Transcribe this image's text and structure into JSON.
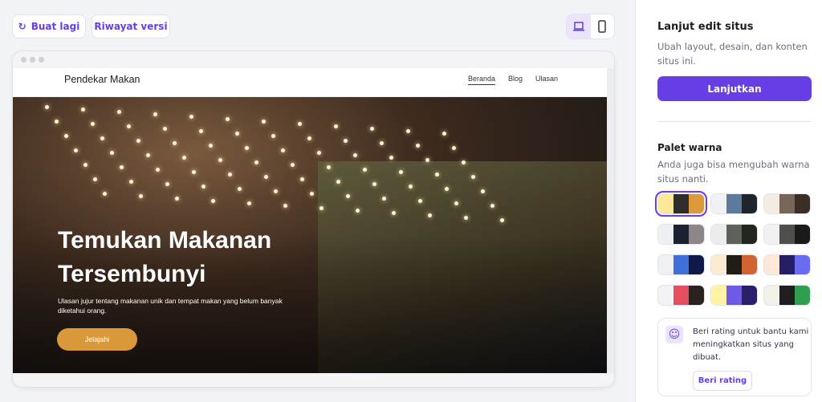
{
  "toolbar": {
    "regenerate_label": "Buat lagi",
    "history_label": "Riwayat versi",
    "regenerate_icon": "refresh-icon",
    "desktop_icon": "laptop-icon",
    "mobile_icon": "phone-icon"
  },
  "preview": {
    "brand": "Pendekar Makan",
    "nav": [
      "Beranda",
      "Blog",
      "Ulasan"
    ],
    "hero_title": "Temukan Makanan Tersembunyi",
    "hero_subtitle": "Ulasan jujur tentang makanan unik dan tempat makan yang belum banyak diketahui orang.",
    "cta": "Jelajahi"
  },
  "panel": {
    "title": "Lanjut edit situs",
    "desc": "Ubah layout, desain, dan konten situs ini.",
    "continue": "Lanjutkan",
    "palette_title": "Palet warna",
    "palette_desc": "Anda juga bisa mengubah warna situs nanti.",
    "palettes": [
      [
        "#fde89a",
        "#2d2d2d",
        "#dc9a3c"
      ],
      [
        "#f1f1f5",
        "#5b7a9c",
        "#1f252d"
      ],
      [
        "#f4ebe3",
        "#776657",
        "#3b2e27"
      ],
      [
        "#eeeff2",
        "#1c2130",
        "#8d8589"
      ],
      [
        "#ececec",
        "#5d6259",
        "#24251f"
      ],
      [
        "#f0f1f3",
        "#4f504e",
        "#1a1a1a"
      ],
      [
        "#eef0f4",
        "#3f6fd8",
        "#0f1a48"
      ],
      [
        "#fcebd0",
        "#201c18",
        "#d06532"
      ],
      [
        "#fde8da",
        "#251f66",
        "#6a6af3"
      ],
      [
        "#f2f3f6",
        "#e34f5e",
        "#2b221f"
      ],
      [
        "#fff3a6",
        "#6e5ae6",
        "#28216a"
      ],
      [
        "#f3efe9",
        "#1d1e1d",
        "#2f9e50"
      ]
    ],
    "selected_palette": 0,
    "rating_text": "Beri rating untuk bantu kami meningkatkan situs yang dibuat.",
    "rating_button": "Beri rating"
  },
  "colors": {
    "accent": "#673de6",
    "cta": "#d9983a"
  }
}
